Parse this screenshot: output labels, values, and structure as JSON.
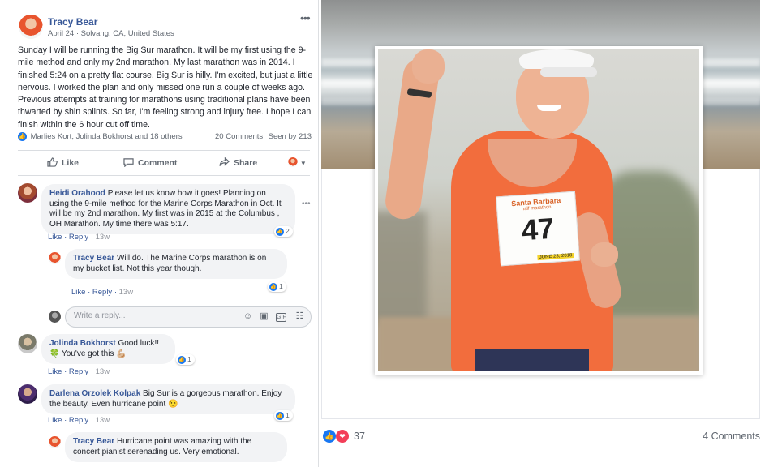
{
  "post": {
    "author": "Tracy Bear",
    "meta": "April 24 · Solvang, CA, United States",
    "text": "Sunday I will be running the Big Sur marathon. It will be my first using the 9-mile method and only my 2nd marathon. My last marathon was in 2014. I finished 5:24 on a pretty flat course. Big Sur is hilly. I'm excited, but just a little nervous. I worked the plan and only missed one run a couple of weeks ago. Previous attempts at training for marathons using traditional plans have been thwarted by shin splints. So far, I'm feeling strong and injury free. I hope I can finish within the 6 hour cut off time.",
    "reactors": "Marlies Kort, Jolinda Bokhorst and 18 others",
    "comments_count": "20 Comments",
    "seen_by": "Seen by 213",
    "options_glyph": "•••"
  },
  "actions": {
    "like": "Like",
    "comment": "Comment",
    "share": "Share"
  },
  "comments": [
    {
      "author": "Heidi Orahood",
      "text": "Please let us know how it goes! Planning on using the 9-mile method for the Marine Corps Marathon in Oct. It will be my 2nd marathon. My first was in 2015 at the Columbus , OH Marathon. My time there was 5:17.",
      "like": "Like",
      "reply": "Reply",
      "time": "13w",
      "reactions": "2"
    },
    {
      "author": "Tracy Bear",
      "text": "Will do. The Marine Corps marathon is on my bucket list. Not this year though.",
      "like": "Like",
      "reply": "Reply",
      "time": "13w",
      "reactions": "1"
    },
    {
      "author": "Jolinda Bokhorst",
      "text": "Good luck!! 🍀 You've got this 💪🏼",
      "like": "Like",
      "reply": "Reply",
      "time": "13w",
      "reactions": "1"
    },
    {
      "author": "Darlena Orzolek Kolpak",
      "text": "Big Sur is a gorgeous marathon. Enjoy the beauty. Even hurricane point 😉",
      "like": "Like",
      "reply": "Reply",
      "time": "13w",
      "reactions": "1"
    },
    {
      "author": "Tracy Bear",
      "text": "Hurricane point was amazing with the concert pianist serenading us. Very emotional."
    }
  ],
  "reply_input": {
    "placeholder": "Write a reply..."
  },
  "photo": {
    "bib_number": "47",
    "bib_title": "Santa Barbara",
    "bib_subtitle": "half marathon",
    "bib_date": "JUNE 23, 2018"
  },
  "photo_footer": {
    "reaction_count": "37",
    "comments": "4 Comments"
  },
  "colors": {
    "link_blue": "#385898",
    "like_blue": "#1877f2",
    "love_red": "#f33e58",
    "shirt_orange": "#f26d3d"
  }
}
